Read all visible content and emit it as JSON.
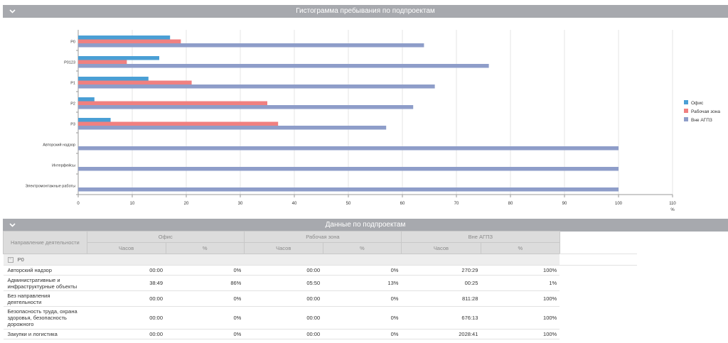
{
  "chart_panel": {
    "title": "Гистограмма пребывания по подпроектам"
  },
  "table_panel": {
    "title": "Данные по подпроектам"
  },
  "chart_data": {
    "type": "bar",
    "orientation": "horizontal",
    "categories": [
      "P0",
      "P0123",
      "P1",
      "P2",
      "P3",
      "Авторский надзор",
      "Интерфейсы",
      "Электромонтажные работы"
    ],
    "series": [
      {
        "name": "Офис",
        "color": "#4a9fd5",
        "values": [
          17,
          15,
          13,
          3,
          6,
          0,
          0,
          0
        ]
      },
      {
        "name": "Рабочая зона",
        "color": "#f08080",
        "values": [
          19,
          9,
          21,
          35,
          37,
          0,
          0,
          0
        ]
      },
      {
        "name": "Вне АГПЗ",
        "color": "#8e9dc9",
        "values": [
          64,
          76,
          66,
          62,
          57,
          100,
          100,
          100
        ]
      }
    ],
    "xticks": [
      "0",
      "10",
      "20",
      "30",
      "40",
      "50",
      "60",
      "70",
      "80",
      "90",
      "100",
      "110"
    ],
    "xlim": [
      0,
      110
    ],
    "xunit": "%",
    "legend_position": "right",
    "grid": true
  },
  "table": {
    "columns": {
      "activity": "Направление деятельности",
      "office": "Офис",
      "work_zone": "Рабочая зона",
      "outside": "Вне АГПЗ",
      "hours": "Часов",
      "percent": "%"
    },
    "group": {
      "expander": "−",
      "name": "P0"
    },
    "rows": [
      {
        "name": "Авторский надзор",
        "office_h": "00:00",
        "office_p": "0%",
        "work_h": "00:00",
        "work_p": "0%",
        "out_h": "270:29",
        "out_p": "100%"
      },
      {
        "name": "Административные и инфраструктурные объекты",
        "office_h": "38:49",
        "office_p": "86%",
        "work_h": "05:50",
        "work_p": "13%",
        "out_h": "00:25",
        "out_p": "1%"
      },
      {
        "name": "Без направления деятельности",
        "office_h": "00:00",
        "office_p": "0%",
        "work_h": "00:00",
        "work_p": "0%",
        "out_h": "811:28",
        "out_p": "100%"
      },
      {
        "name": "Безопасность труда, охрана здоровья, безопасность дорожного",
        "office_h": "00:00",
        "office_p": "0%",
        "work_h": "00:00",
        "work_p": "0%",
        "out_h": "676:13",
        "out_p": "100%"
      },
      {
        "name": "Закупки и логистика",
        "office_h": "00:00",
        "office_p": "0%",
        "work_h": "00:00",
        "work_p": "0%",
        "out_h": "2028:41",
        "out_p": "100%"
      }
    ]
  }
}
